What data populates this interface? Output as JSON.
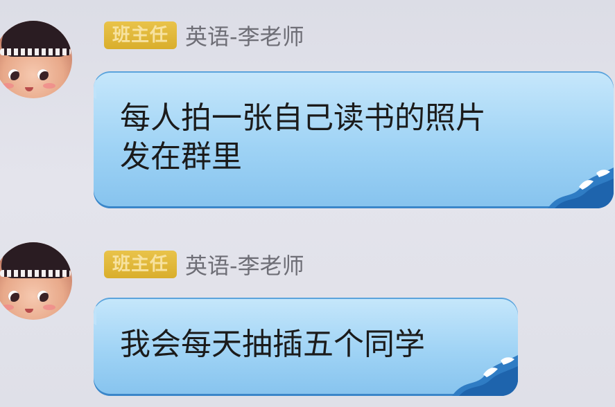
{
  "messages": [
    {
      "badge": "班主任",
      "sender": "英语-李老师",
      "text_lines": [
        "每人拍一张自己读书的照片",
        "发在群里"
      ]
    },
    {
      "badge": "班主任",
      "sender": "英语-李老师",
      "text_lines": [
        "我会每天抽插五个同学"
      ]
    }
  ],
  "colors": {
    "background": "#e0e0e8",
    "bubble": "#9fd3f5",
    "badge": "#d9ae2c",
    "sender_text": "#6e6e76"
  }
}
